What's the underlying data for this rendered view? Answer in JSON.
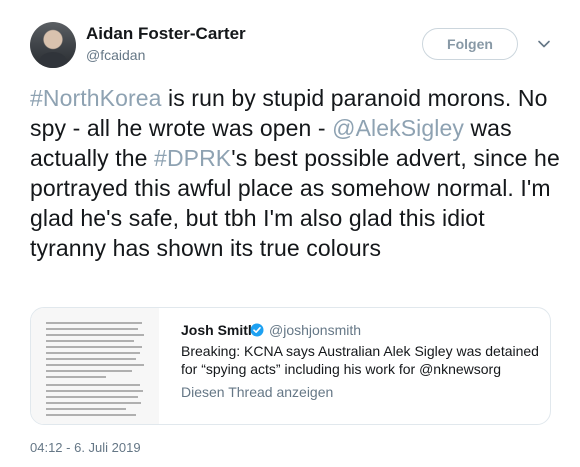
{
  "author": {
    "display_name": "Aidan Foster-Carter",
    "handle": "@fcaidan"
  },
  "follow_button": {
    "label": "Folgen"
  },
  "tweet": {
    "segments": [
      {
        "text": "#NorthKorea",
        "type": "hashtag"
      },
      {
        "text": " is run by stupid paranoid morons. No spy - all he wrote was open - ",
        "type": "text"
      },
      {
        "text": "@AlekSigley",
        "type": "mention"
      },
      {
        "text": " was actually the ",
        "type": "text"
      },
      {
        "text": "#DPRK",
        "type": "hashtag"
      },
      {
        "text": "'s best possible advert, since he portrayed this awful place as somehow normal. I'm glad he's safe, but tbh I'm also glad this idiot tyranny has shown its true colours",
        "type": "text"
      }
    ]
  },
  "quoted_tweet": {
    "display_name": "Josh Smith",
    "handle": "@joshjonsmith",
    "text": "Breaking: KCNA says Australian Alek Sigley was detained for “spying acts” including his work for @nknewsorg",
    "show_thread_label": "Diesen Thread anzeigen",
    "thumbnail": "document-screenshot-image"
  },
  "timestamp": "04:12 - 6. Juli 2019",
  "colors": {
    "link": "#8ea2b2",
    "secondary_text": "#657786",
    "verified": "#1da1f2"
  }
}
